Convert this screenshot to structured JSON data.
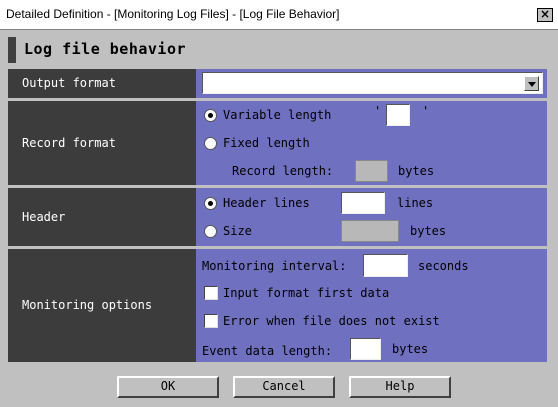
{
  "window": {
    "title": "Detailed Definition - [Monitoring Log Files] - [Log File Behavior]",
    "close_glyph": "×"
  },
  "section": {
    "title": "Log file behavior"
  },
  "output_format": {
    "label": "Output format",
    "value": ""
  },
  "record_format": {
    "label": "Record format",
    "variable_label": "Variable length",
    "variable_selected": true,
    "quote_open": "'",
    "quote_close": "'",
    "delimiter_value": "",
    "fixed_label": "Fixed length",
    "fixed_selected": false,
    "record_length_label": "Record length:",
    "record_length_value": "",
    "record_length_unit": "bytes"
  },
  "header": {
    "label": "Header",
    "lines_label": "Header lines",
    "lines_selected": true,
    "lines_value": "",
    "lines_unit": "lines",
    "size_label": "Size",
    "size_selected": false,
    "size_value": "",
    "size_unit": "bytes"
  },
  "monitoring": {
    "label": "Monitoring options",
    "interval_label": "Monitoring interval:",
    "interval_value": "",
    "interval_unit": "seconds",
    "first_data_label": "Input format first data",
    "first_data_checked": false,
    "error_label": "Error when file does not exist",
    "error_checked": false,
    "event_length_label": "Event data length:",
    "event_length_value": "",
    "event_length_unit": "bytes"
  },
  "buttons": {
    "ok": "OK",
    "cancel": "Cancel",
    "help": "Help"
  },
  "colors": {
    "label_bg": "#3c3c3c",
    "control_bg": "#7070c0",
    "window_bg": "#c0c0c0"
  }
}
